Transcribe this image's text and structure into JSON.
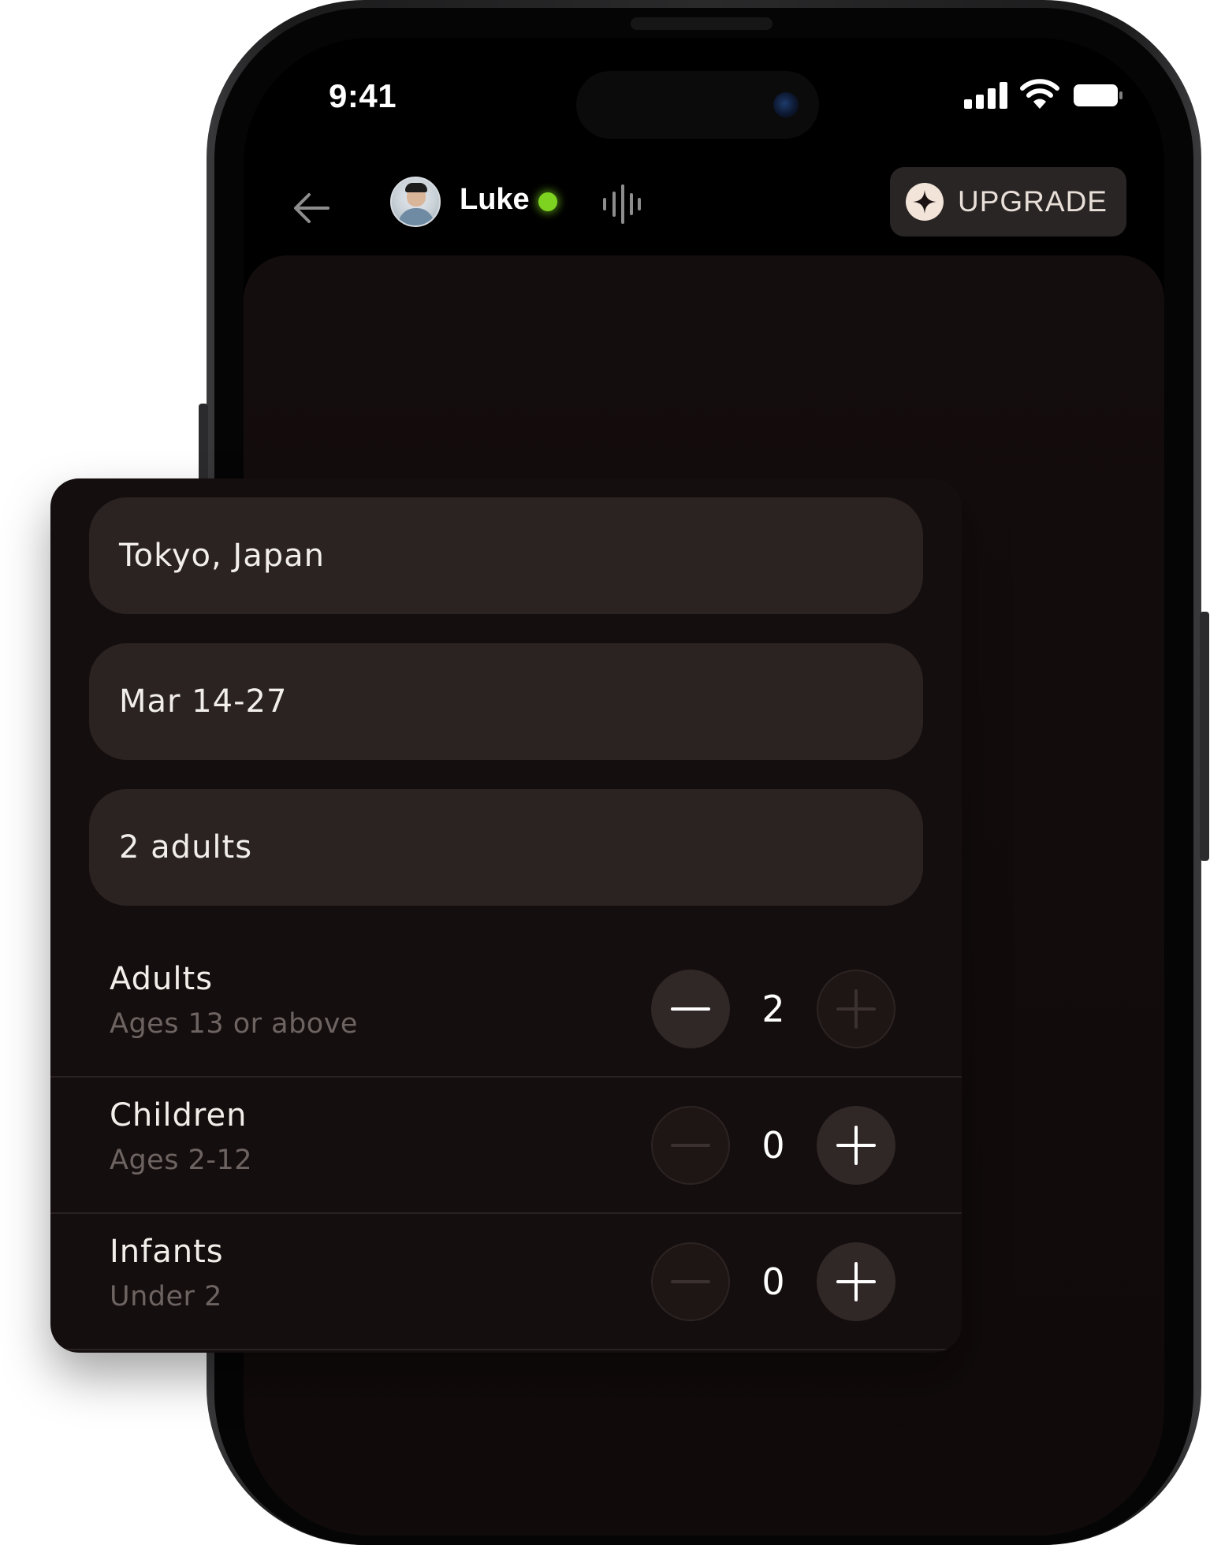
{
  "status_bar": {
    "time": "9:41"
  },
  "header": {
    "back_icon": "arrow-left-icon",
    "user_name": "Luke",
    "status": "online",
    "status_color": "#7ed321",
    "voice_icon": "voice-wave-icon",
    "upgrade_label": "UPGRADE",
    "upgrade_icon": "sparkle-plus-icon"
  },
  "booking": {
    "destination": "Tokyo, Japan",
    "dates": "Mar 14-27",
    "guests_summary": "2 adults",
    "guest_types": [
      {
        "title": "Adults",
        "subtitle": "Ages 13 or above",
        "count": "2",
        "minus_enabled": true,
        "plus_enabled": false
      },
      {
        "title": "Children",
        "subtitle": "Ages 2-12",
        "count": "0",
        "minus_enabled": false,
        "plus_enabled": true
      },
      {
        "title": "Infants",
        "subtitle": "Under 2",
        "count": "0",
        "minus_enabled": false,
        "plus_enabled": true
      }
    ]
  },
  "colors": {
    "background": "#000000",
    "card": "#150e0e",
    "field": "#2a2321",
    "text_primary": "#f2eeea",
    "text_secondary": "#6d6462",
    "online": "#7ed321"
  }
}
